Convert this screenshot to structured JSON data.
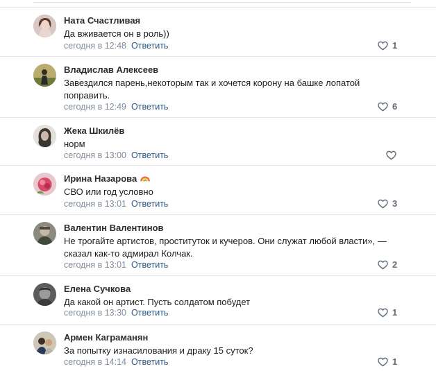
{
  "colors": {
    "author": "#2c2d2e",
    "text": "#1c1c1e",
    "time": "#818c99",
    "reply_link": "#2a5885",
    "like_icon": "#626d7a",
    "separator": "#e7e8ec"
  },
  "comments": [
    {
      "author": "Ната Счастливая",
      "text": "Да вживается он в роль))",
      "time": "сегодня в 12:48",
      "reply_label": "Ответить",
      "likes": "1",
      "avatar_icon": "user-avatar-icon"
    },
    {
      "author": "Владислав Алексеев",
      "text": "Завездился парень,некоторым так и хочется корону на башке лопатой поправить.",
      "time": "сегодня в 12:49",
      "reply_label": "Ответить",
      "likes": "6",
      "avatar_icon": "user-avatar-icon"
    },
    {
      "author": "Жека Шкилёв",
      "text": "норм",
      "time": "сегодня в 13:00",
      "reply_label": "Ответить",
      "likes": "",
      "avatar_icon": "user-avatar-icon"
    },
    {
      "author": "Ирина Назарова",
      "author_emoji": "rainbow-icon",
      "text": "СВО или год условно",
      "time": "сегодня в 13:01",
      "reply_label": "Ответить",
      "likes": "3",
      "avatar_icon": "user-avatar-icon"
    },
    {
      "author": "Валентин Валентинов",
      "text": "Не трогайте артистов, проституток и кучеров. Они служат любой власти», — сказал как-то адмирал Колчак.",
      "time": "сегодня в 13:01",
      "reply_label": "Ответить",
      "likes": "2",
      "avatar_icon": "user-avatar-icon"
    },
    {
      "author": "Елена Сучкова",
      "text": "Да какой он артист. Пусть солдатом побудет",
      "time": "сегодня в 13:30",
      "reply_label": "Ответить",
      "likes": "1",
      "avatar_icon": "user-avatar-icon"
    },
    {
      "author": "Армен Каграманян",
      "text": "За попытку изнасилования и драку 15 суток?",
      "time": "сегодня в 14:14",
      "reply_label": "Ответить",
      "likes": "1",
      "avatar_icon": "user-avatar-icon"
    }
  ]
}
